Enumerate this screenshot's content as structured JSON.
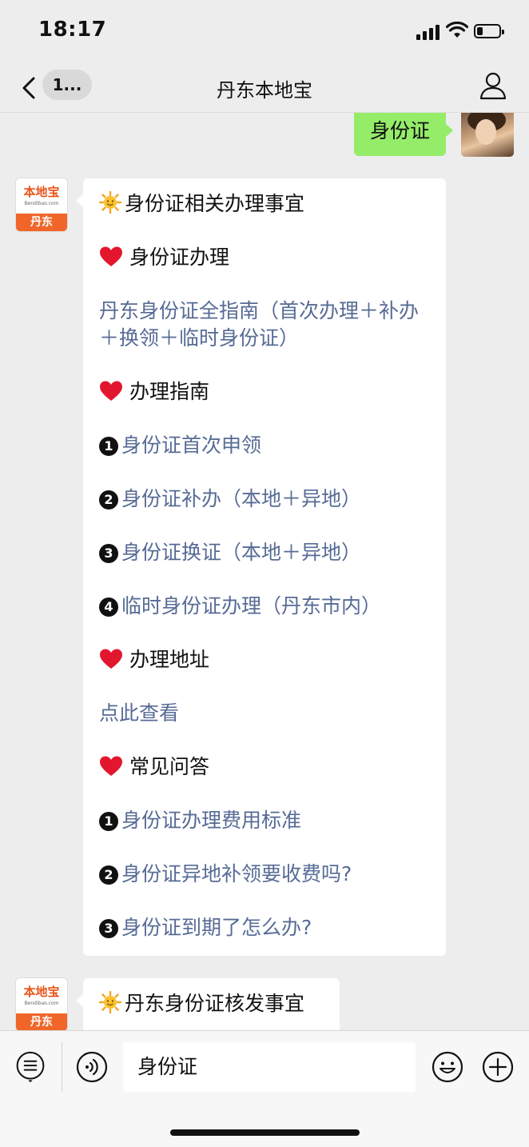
{
  "status_bar": {
    "time": "18:17"
  },
  "nav": {
    "back_badge": "1...",
    "title": "丹东本地宝"
  },
  "outgoing_message": {
    "text": "身份证"
  },
  "bot": {
    "avatar_brand": "本地宝",
    "avatar_sub": "Bendibao.com",
    "avatar_city": "丹东"
  },
  "message1": {
    "title": "身份证相关办理事宜",
    "section1": {
      "heading": "身份证办理",
      "link": "丹东身份证全指南（首次办理＋补办＋换领＋临时身份证）"
    },
    "section2": {
      "heading": "办理指南",
      "items": [
        {
          "num": "1",
          "text": "身份证首次申领"
        },
        {
          "num": "2",
          "text": "身份证补办（本地＋异地）"
        },
        {
          "num": "3",
          "text": "身份证换证（本地＋异地）"
        },
        {
          "num": "4",
          "text": "临时身份证办理（丹东市内）"
        }
      ]
    },
    "section3": {
      "heading": "办理地址",
      "link": "点此查看"
    },
    "section4": {
      "heading": "常见问答",
      "items": [
        {
          "num": "1",
          "text": "身份证办理费用标准"
        },
        {
          "num": "2",
          "text": "身份证异地补领要收费吗?"
        },
        {
          "num": "3",
          "text": "身份证到期了怎么办?"
        }
      ]
    }
  },
  "message2": {
    "title": "丹东身份证核发事宜"
  },
  "input_bar": {
    "value": "身份证"
  },
  "colors": {
    "outgoing_bubble": "#95ec69",
    "link": "#576b95",
    "background": "#ededed"
  }
}
